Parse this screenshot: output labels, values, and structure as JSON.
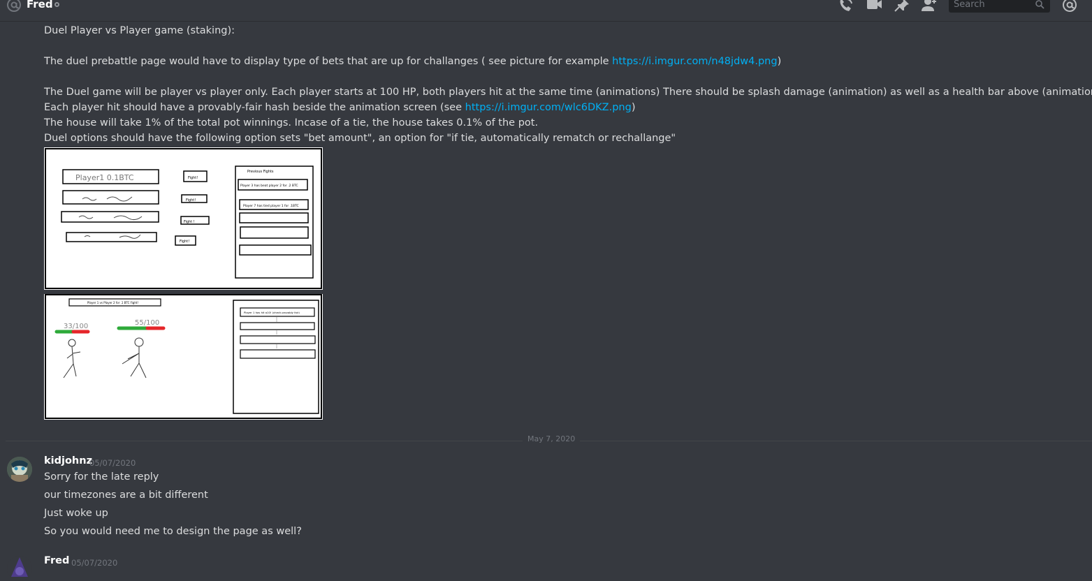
{
  "header": {
    "channel_name": "Fred",
    "search_placeholder": "Search"
  },
  "message_top": {
    "lines": [
      {
        "text": "Duel Player vs Player game (staking):"
      },
      {
        "text": "The duel prebattle page would have to display type of bets that are up for challanges ( see picture for example ",
        "link": "https://i.imgur.com/n48jdw4.png",
        "after": ")"
      },
      {
        "text": "The Duel game will be player vs player only. Each player starts at 100 HP, both players hit at the same time (animations) There should be splash damage (animation)  as well as a health bar above (animation)."
      },
      {
        "text": "Each player hit should have a provably-fair hash beside the animation screen (see ",
        "link": "https://i.imgur.com/wlc6DKZ.png",
        "after": ")"
      },
      {
        "text": "The house will take 1% of the total pot winnings. Incase of a tie, the house takes 0.1% of the pot."
      },
      {
        "text": "Duel options should have the following option sets \"bet amount\", an option for \"if tie, automatically rematch or rechallange\""
      }
    ]
  },
  "sketch": {
    "top": {
      "player1_text": "Player1  0.1BTC",
      "fight_labels": [
        "Fight!",
        "Fight!",
        "Fight !",
        "Fight!"
      ],
      "previous_title": "Previous Fights",
      "previous_rows": [
        "Player 3 has beat player 2 for .2 BTC",
        "Player 7 has tied player 1 for .1BTC"
      ]
    },
    "bottom": {
      "title": "Player 1 vs Player 2 for .1 BTC Fight!",
      "hp_left": "33/100",
      "hp_right": "55/100",
      "log_row": "Player 1 has hit a10!     (check provably fair)"
    }
  },
  "divider": {
    "date": "May 7, 2020"
  },
  "messages": [
    {
      "author": "kidjohnz",
      "timestamp": "05/07/2020",
      "lines": [
        "Sorry for the late reply",
        "our timezones are a bit different",
        "Just woke up",
        "So you would need me to design the page as well?"
      ]
    },
    {
      "author": "Fred",
      "timestamp": "05/07/2020"
    }
  ]
}
